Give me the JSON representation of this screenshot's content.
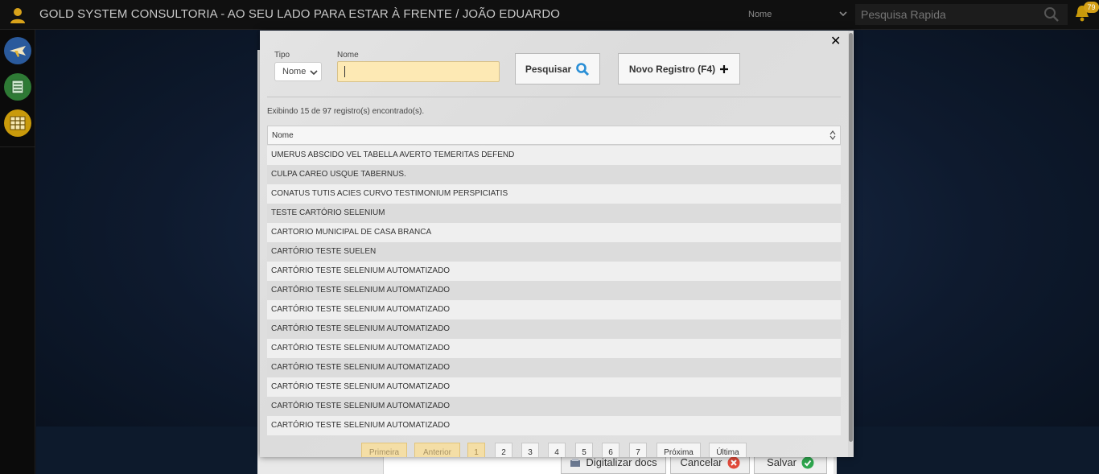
{
  "app": {
    "title": "GOLD SYSTEM CONSULTORIA - AO SEU LADO PARA ESTAR À FRENTE / JOÃO EDUARDO",
    "search_type_selected": "Nome",
    "quick_search_placeholder": "Pesquisa Rapida",
    "notification_count": "79"
  },
  "rail": {
    "icons": [
      "airplane-icon",
      "list-icon",
      "grid-icon"
    ],
    "colors": [
      "#2a5a9c",
      "#2e7a35",
      "#c99a0b"
    ]
  },
  "background_form": {
    "buttons": {
      "scan": "Digitalizar docs",
      "cancel": "Cancelar",
      "save": "Salvar"
    }
  },
  "modal": {
    "labels": {
      "tipo": "Tipo",
      "nome": "Nome"
    },
    "tipo_selected": "Nome",
    "nome_value": "",
    "buttons": {
      "search": "Pesquisar",
      "new_record": "Novo Registro (F4)"
    },
    "summary": "Exibindo 15 de 97 registro(s) encontrado(s).",
    "grid": {
      "column_header": "Nome",
      "rows": [
        "UMERUS ABSCIDO VEL TABELLA AVERTO TEMERITAS DEFEND",
        "CULPA CAREO USQUE TABERNUS.",
        "CONATUS TUTIS ACIES CURVO TESTIMONIUM PERSPICIATIS",
        "TESTE CARTÓRIO SELENIUM",
        "CARTORIO MUNICIPAL DE CASA BRANCA",
        "CARTÓRIO TESTE SUELEN",
        "CARTÓRIO TESTE SELENIUM AUTOMATIZADO",
        "CARTÓRIO TESTE SELENIUM AUTOMATIZADO",
        "CARTÓRIO TESTE SELENIUM AUTOMATIZADO",
        "CARTÓRIO TESTE SELENIUM AUTOMATIZADO",
        "CARTÓRIO TESTE SELENIUM AUTOMATIZADO",
        "CARTÓRIO TESTE SELENIUM AUTOMATIZADO",
        "CARTÓRIO TESTE SELENIUM AUTOMATIZADO",
        "CARTÓRIO TESTE SELENIUM AUTOMATIZADO",
        "CARTÓRIO TESTE SELENIUM AUTOMATIZADO"
      ]
    },
    "pagination": {
      "first": "Primeira",
      "previous": "Anterior",
      "pages": [
        "1",
        "2",
        "3",
        "4",
        "5",
        "6",
        "7"
      ],
      "current_page": "1",
      "next": "Próxima",
      "last": "Última"
    }
  },
  "colors": {
    "input_highlight": "#fde9b4",
    "accent_blue": "#2a8fd6",
    "cancel_red": "#e24b3b",
    "save_green": "#2fa84f",
    "gold": "#c99a0b"
  }
}
